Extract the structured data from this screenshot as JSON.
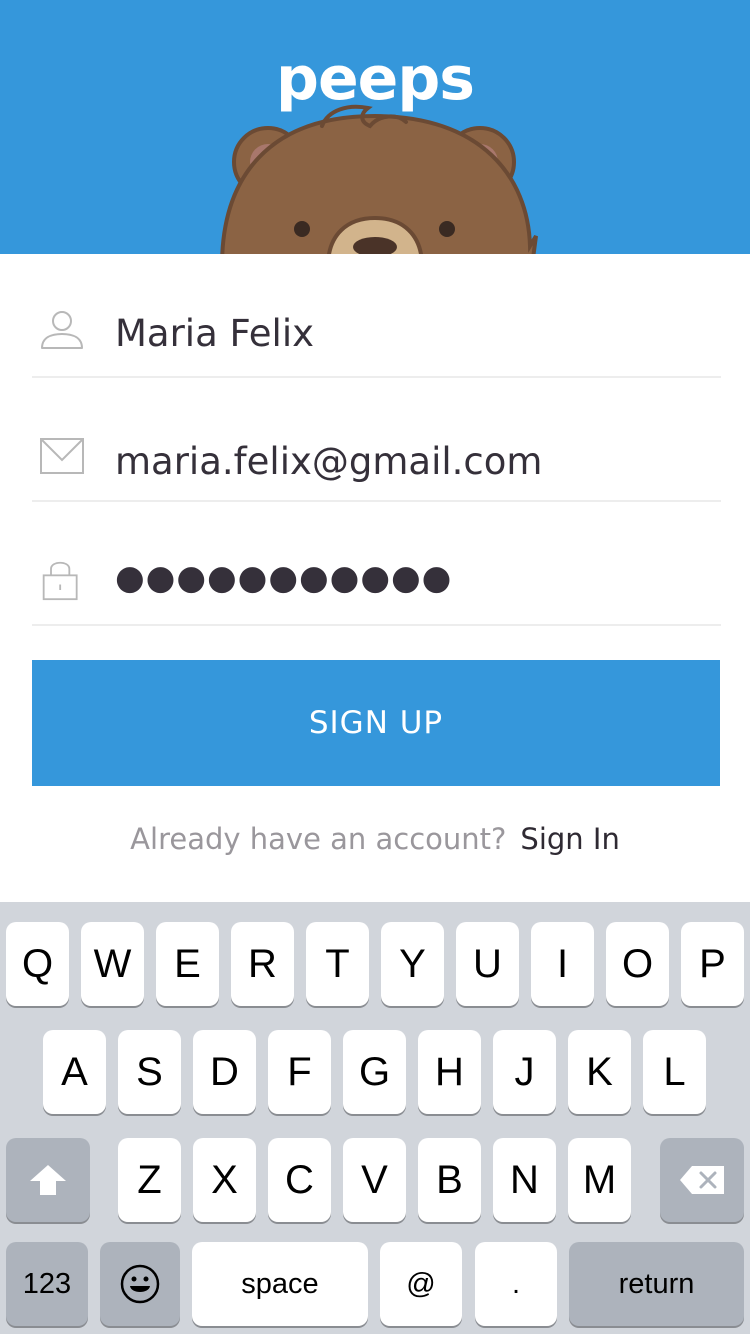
{
  "app": {
    "logo": "peeps",
    "brand_color": "#3597db"
  },
  "form": {
    "name_value": "Maria Felix",
    "email_value": "maria.felix@gmail.com",
    "password_value": "●●●●●●●●●●●",
    "icons": {
      "name": "user-icon",
      "email": "envelope-icon",
      "password": "lock-icon"
    }
  },
  "signup_button": "SIGN UP",
  "signin": {
    "prompt": "Already have an account?",
    "link": "Sign In"
  },
  "keyboard": {
    "row1": [
      "Q",
      "W",
      "E",
      "R",
      "T",
      "Y",
      "U",
      "I",
      "O",
      "P"
    ],
    "row2": [
      "A",
      "S",
      "D",
      "F",
      "G",
      "H",
      "J",
      "K",
      "L"
    ],
    "row3": [
      "Z",
      "X",
      "C",
      "V",
      "B",
      "N",
      "M"
    ],
    "numbers": "123",
    "space": "space",
    "at": "@",
    "period": ".",
    "return": "return"
  }
}
